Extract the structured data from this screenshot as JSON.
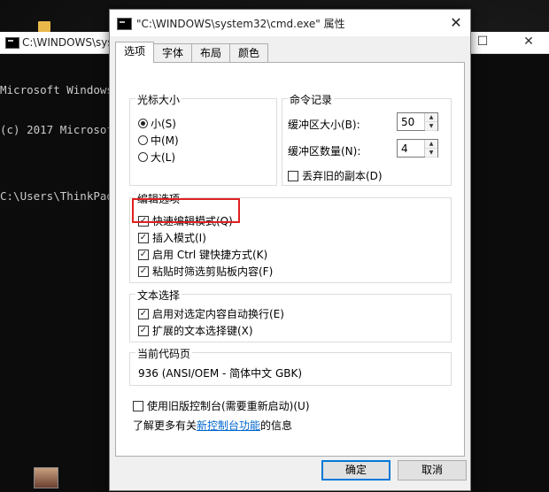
{
  "console": {
    "title": "C:\\WINDOWS\\syst",
    "lines": [
      "Microsoft Windows",
      "(c) 2017 Microsof",
      "",
      "C:\\Users\\ThinkPad"
    ],
    "minimize": "—",
    "maximize": "☐"
  },
  "dialog": {
    "title": "\"C:\\WINDOWS\\system32\\cmd.exe\" 属性",
    "close": "✕",
    "tabs": [
      {
        "label": "选项",
        "active": true
      },
      {
        "label": "字体",
        "active": false
      },
      {
        "label": "布局",
        "active": false
      },
      {
        "label": "颜色",
        "active": false
      }
    ],
    "cursor_size": {
      "label": "光标大小",
      "options": [
        {
          "label": "小(S)",
          "selected": true
        },
        {
          "label": "中(M)",
          "selected": false
        },
        {
          "label": "大(L)",
          "selected": false
        }
      ]
    },
    "command_history": {
      "label": "命令记录",
      "buffer_size_label": "缓冲区大小(B):",
      "buffer_size_value": "50",
      "buffer_count_label": "缓冲区数量(N):",
      "buffer_count_value": "4",
      "discard_label": "丢弃旧的副本(D)",
      "discard_checked": false
    },
    "edit_options": {
      "label": "编辑选项",
      "items": [
        {
          "label": "快速编辑模式(Q)",
          "checked": true
        },
        {
          "label": "插入模式(I)",
          "checked": true
        },
        {
          "label": "启用 Ctrl 键快捷方式(K)",
          "checked": true
        },
        {
          "label": "粘贴时筛选剪贴板内容(F)",
          "checked": true
        }
      ]
    },
    "text_selection": {
      "label": "文本选择",
      "items": [
        {
          "label": "启用对选定内容自动换行(E)",
          "checked": true
        },
        {
          "label": "扩展的文本选择键(X)",
          "checked": true
        }
      ]
    },
    "codepage": {
      "label": "当前代码页",
      "value": "936   (ANSI/OEM - 简体中文 GBK)"
    },
    "legacy_console": {
      "label": "使用旧版控制台(需要重新启动)(U)",
      "checked": false
    },
    "learn_more": {
      "prefix": "了解更多有关",
      "link": "新控制台功能",
      "suffix": "的信息"
    },
    "ok_label": "确定",
    "cancel_label": "取消"
  },
  "colors": {
    "highlight": "#e02020",
    "link": "#0066cc",
    "default_button_border": "#0078d7"
  }
}
